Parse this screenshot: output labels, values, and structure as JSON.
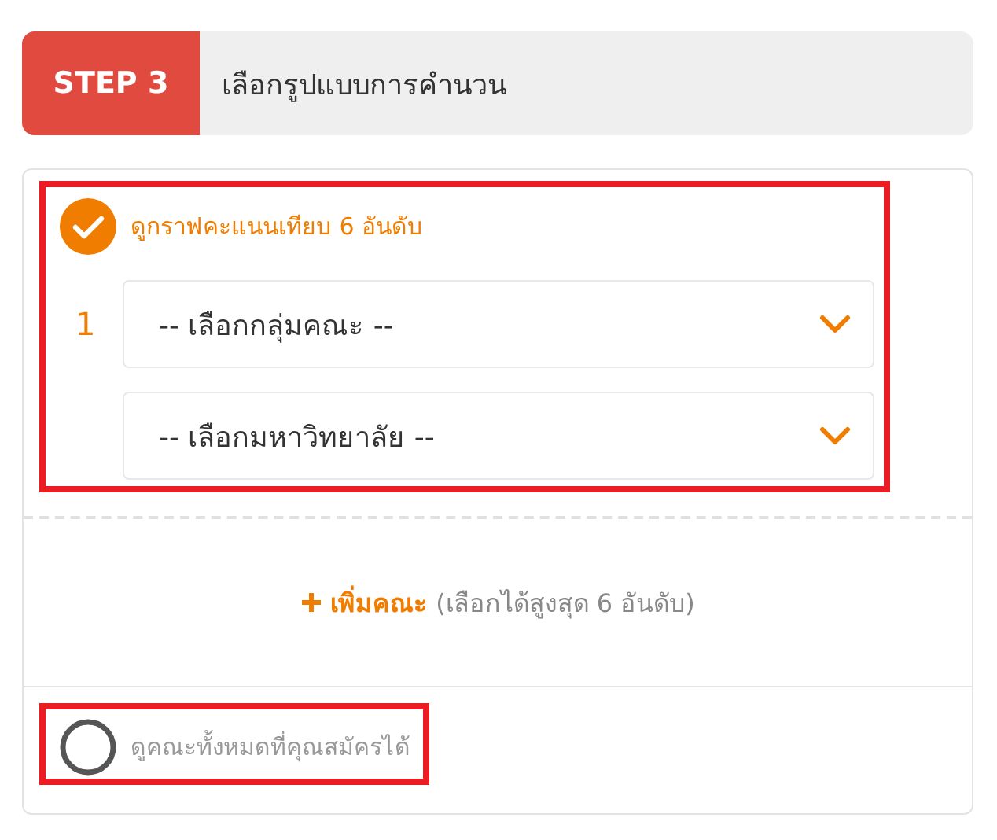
{
  "step": {
    "badge": "STEP 3",
    "title": "เลือกรูปแบบการคำนวน"
  },
  "options": [
    {
      "label": "ดูกราฟคะแนนเทียบ 6 อันดับ",
      "selected": true,
      "highlighted": true,
      "row_number": "1",
      "selects": [
        {
          "placeholder": "-- เลือกกลุ่มคณะ --"
        },
        {
          "placeholder": "-- เลือกมหาวิทยาลัย --"
        }
      ],
      "add": {
        "label": "เพิ่มคณะ",
        "note": "(เลือกได้สูงสุด 6 อันดับ)"
      }
    },
    {
      "label": "ดูคณะทั้งหมดที่คุณสมัครได้",
      "selected": false,
      "highlighted": true
    }
  ]
}
